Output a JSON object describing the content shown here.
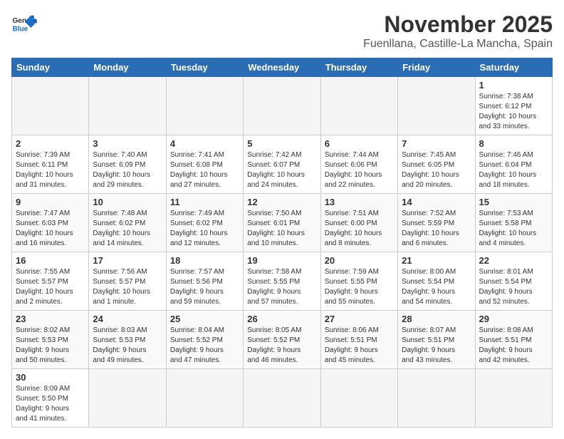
{
  "header": {
    "logo_general": "General",
    "logo_blue": "Blue",
    "month": "November 2025",
    "location": "Fuenllana, Castille-La Mancha, Spain"
  },
  "weekdays": [
    "Sunday",
    "Monday",
    "Tuesday",
    "Wednesday",
    "Thursday",
    "Friday",
    "Saturday"
  ],
  "weeks": [
    [
      {
        "day": "",
        "info": ""
      },
      {
        "day": "",
        "info": ""
      },
      {
        "day": "",
        "info": ""
      },
      {
        "day": "",
        "info": ""
      },
      {
        "day": "",
        "info": ""
      },
      {
        "day": "",
        "info": ""
      },
      {
        "day": "1",
        "info": "Sunrise: 7:38 AM\nSunset: 6:12 PM\nDaylight: 10 hours\nand 33 minutes."
      }
    ],
    [
      {
        "day": "2",
        "info": "Sunrise: 7:39 AM\nSunset: 6:11 PM\nDaylight: 10 hours\nand 31 minutes."
      },
      {
        "day": "3",
        "info": "Sunrise: 7:40 AM\nSunset: 6:09 PM\nDaylight: 10 hours\nand 29 minutes."
      },
      {
        "day": "4",
        "info": "Sunrise: 7:41 AM\nSunset: 6:08 PM\nDaylight: 10 hours\nand 27 minutes."
      },
      {
        "day": "5",
        "info": "Sunrise: 7:42 AM\nSunset: 6:07 PM\nDaylight: 10 hours\nand 24 minutes."
      },
      {
        "day": "6",
        "info": "Sunrise: 7:44 AM\nSunset: 6:06 PM\nDaylight: 10 hours\nand 22 minutes."
      },
      {
        "day": "7",
        "info": "Sunrise: 7:45 AM\nSunset: 6:05 PM\nDaylight: 10 hours\nand 20 minutes."
      },
      {
        "day": "8",
        "info": "Sunrise: 7:46 AM\nSunset: 6:04 PM\nDaylight: 10 hours\nand 18 minutes."
      }
    ],
    [
      {
        "day": "9",
        "info": "Sunrise: 7:47 AM\nSunset: 6:03 PM\nDaylight: 10 hours\nand 16 minutes."
      },
      {
        "day": "10",
        "info": "Sunrise: 7:48 AM\nSunset: 6:02 PM\nDaylight: 10 hours\nand 14 minutes."
      },
      {
        "day": "11",
        "info": "Sunrise: 7:49 AM\nSunset: 6:02 PM\nDaylight: 10 hours\nand 12 minutes."
      },
      {
        "day": "12",
        "info": "Sunrise: 7:50 AM\nSunset: 6:01 PM\nDaylight: 10 hours\nand 10 minutes."
      },
      {
        "day": "13",
        "info": "Sunrise: 7:51 AM\nSunset: 6:00 PM\nDaylight: 10 hours\nand 8 minutes."
      },
      {
        "day": "14",
        "info": "Sunrise: 7:52 AM\nSunset: 5:59 PM\nDaylight: 10 hours\nand 6 minutes."
      },
      {
        "day": "15",
        "info": "Sunrise: 7:53 AM\nSunset: 5:58 PM\nDaylight: 10 hours\nand 4 minutes."
      }
    ],
    [
      {
        "day": "16",
        "info": "Sunrise: 7:55 AM\nSunset: 5:57 PM\nDaylight: 10 hours\nand 2 minutes."
      },
      {
        "day": "17",
        "info": "Sunrise: 7:56 AM\nSunset: 5:57 PM\nDaylight: 10 hours\nand 1 minute."
      },
      {
        "day": "18",
        "info": "Sunrise: 7:57 AM\nSunset: 5:56 PM\nDaylight: 9 hours\nand 59 minutes."
      },
      {
        "day": "19",
        "info": "Sunrise: 7:58 AM\nSunset: 5:55 PM\nDaylight: 9 hours\nand 57 minutes."
      },
      {
        "day": "20",
        "info": "Sunrise: 7:59 AM\nSunset: 5:55 PM\nDaylight: 9 hours\nand 55 minutes."
      },
      {
        "day": "21",
        "info": "Sunrise: 8:00 AM\nSunset: 5:54 PM\nDaylight: 9 hours\nand 54 minutes."
      },
      {
        "day": "22",
        "info": "Sunrise: 8:01 AM\nSunset: 5:54 PM\nDaylight: 9 hours\nand 52 minutes."
      }
    ],
    [
      {
        "day": "23",
        "info": "Sunrise: 8:02 AM\nSunset: 5:53 PM\nDaylight: 9 hours\nand 50 minutes."
      },
      {
        "day": "24",
        "info": "Sunrise: 8:03 AM\nSunset: 5:53 PM\nDaylight: 9 hours\nand 49 minutes."
      },
      {
        "day": "25",
        "info": "Sunrise: 8:04 AM\nSunset: 5:52 PM\nDaylight: 9 hours\nand 47 minutes."
      },
      {
        "day": "26",
        "info": "Sunrise: 8:05 AM\nSunset: 5:52 PM\nDaylight: 9 hours\nand 46 minutes."
      },
      {
        "day": "27",
        "info": "Sunrise: 8:06 AM\nSunset: 5:51 PM\nDaylight: 9 hours\nand 45 minutes."
      },
      {
        "day": "28",
        "info": "Sunrise: 8:07 AM\nSunset: 5:51 PM\nDaylight: 9 hours\nand 43 minutes."
      },
      {
        "day": "29",
        "info": "Sunrise: 8:08 AM\nSunset: 5:51 PM\nDaylight: 9 hours\nand 42 minutes."
      }
    ],
    [
      {
        "day": "30",
        "info": "Sunrise: 8:09 AM\nSunset: 5:50 PM\nDaylight: 9 hours\nand 41 minutes."
      },
      {
        "day": "",
        "info": ""
      },
      {
        "day": "",
        "info": ""
      },
      {
        "day": "",
        "info": ""
      },
      {
        "day": "",
        "info": ""
      },
      {
        "day": "",
        "info": ""
      },
      {
        "day": "",
        "info": ""
      }
    ]
  ]
}
